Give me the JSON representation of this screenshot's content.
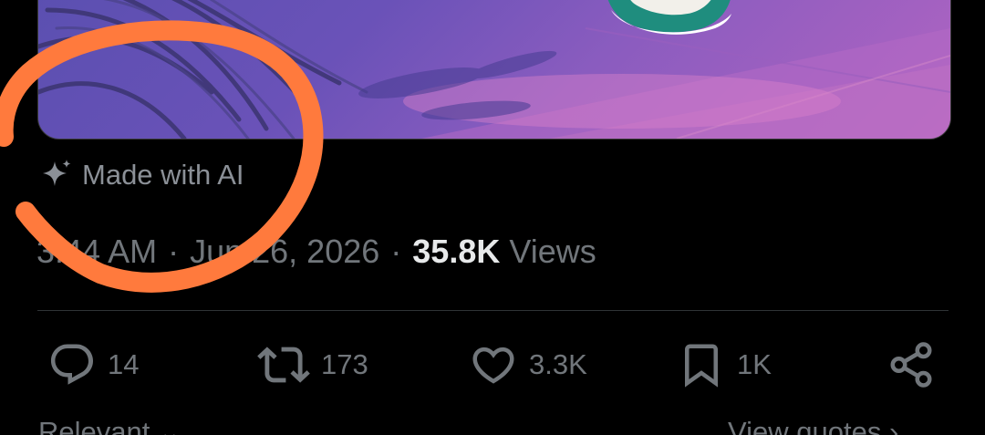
{
  "ai_label": {
    "text": "Made with AI",
    "icon": "sparkle-icon"
  },
  "meta": {
    "time": "3:44 AM",
    "separator1": "·",
    "date": "Jun 26, 2026",
    "separator2": "·",
    "views_count": "35.8K",
    "views_label": "Views"
  },
  "actions": {
    "reply": {
      "icon": "reply-icon",
      "count": "14"
    },
    "repost": {
      "icon": "repost-icon",
      "count": "173"
    },
    "like": {
      "icon": "heart-icon",
      "count": "3.3K"
    },
    "bookmark": {
      "icon": "bookmark-icon",
      "count": "1K"
    },
    "share": {
      "icon": "share-icon"
    }
  },
  "bottom": {
    "left_label": "Relevant",
    "left_chevron": "⌄",
    "right_label": "View quotes",
    "right_chevron": "›"
  },
  "colors": {
    "background": "#000000",
    "muted_text": "#71767b",
    "primary_text": "#e7e9ea",
    "annotation": "#ff7a3d"
  }
}
